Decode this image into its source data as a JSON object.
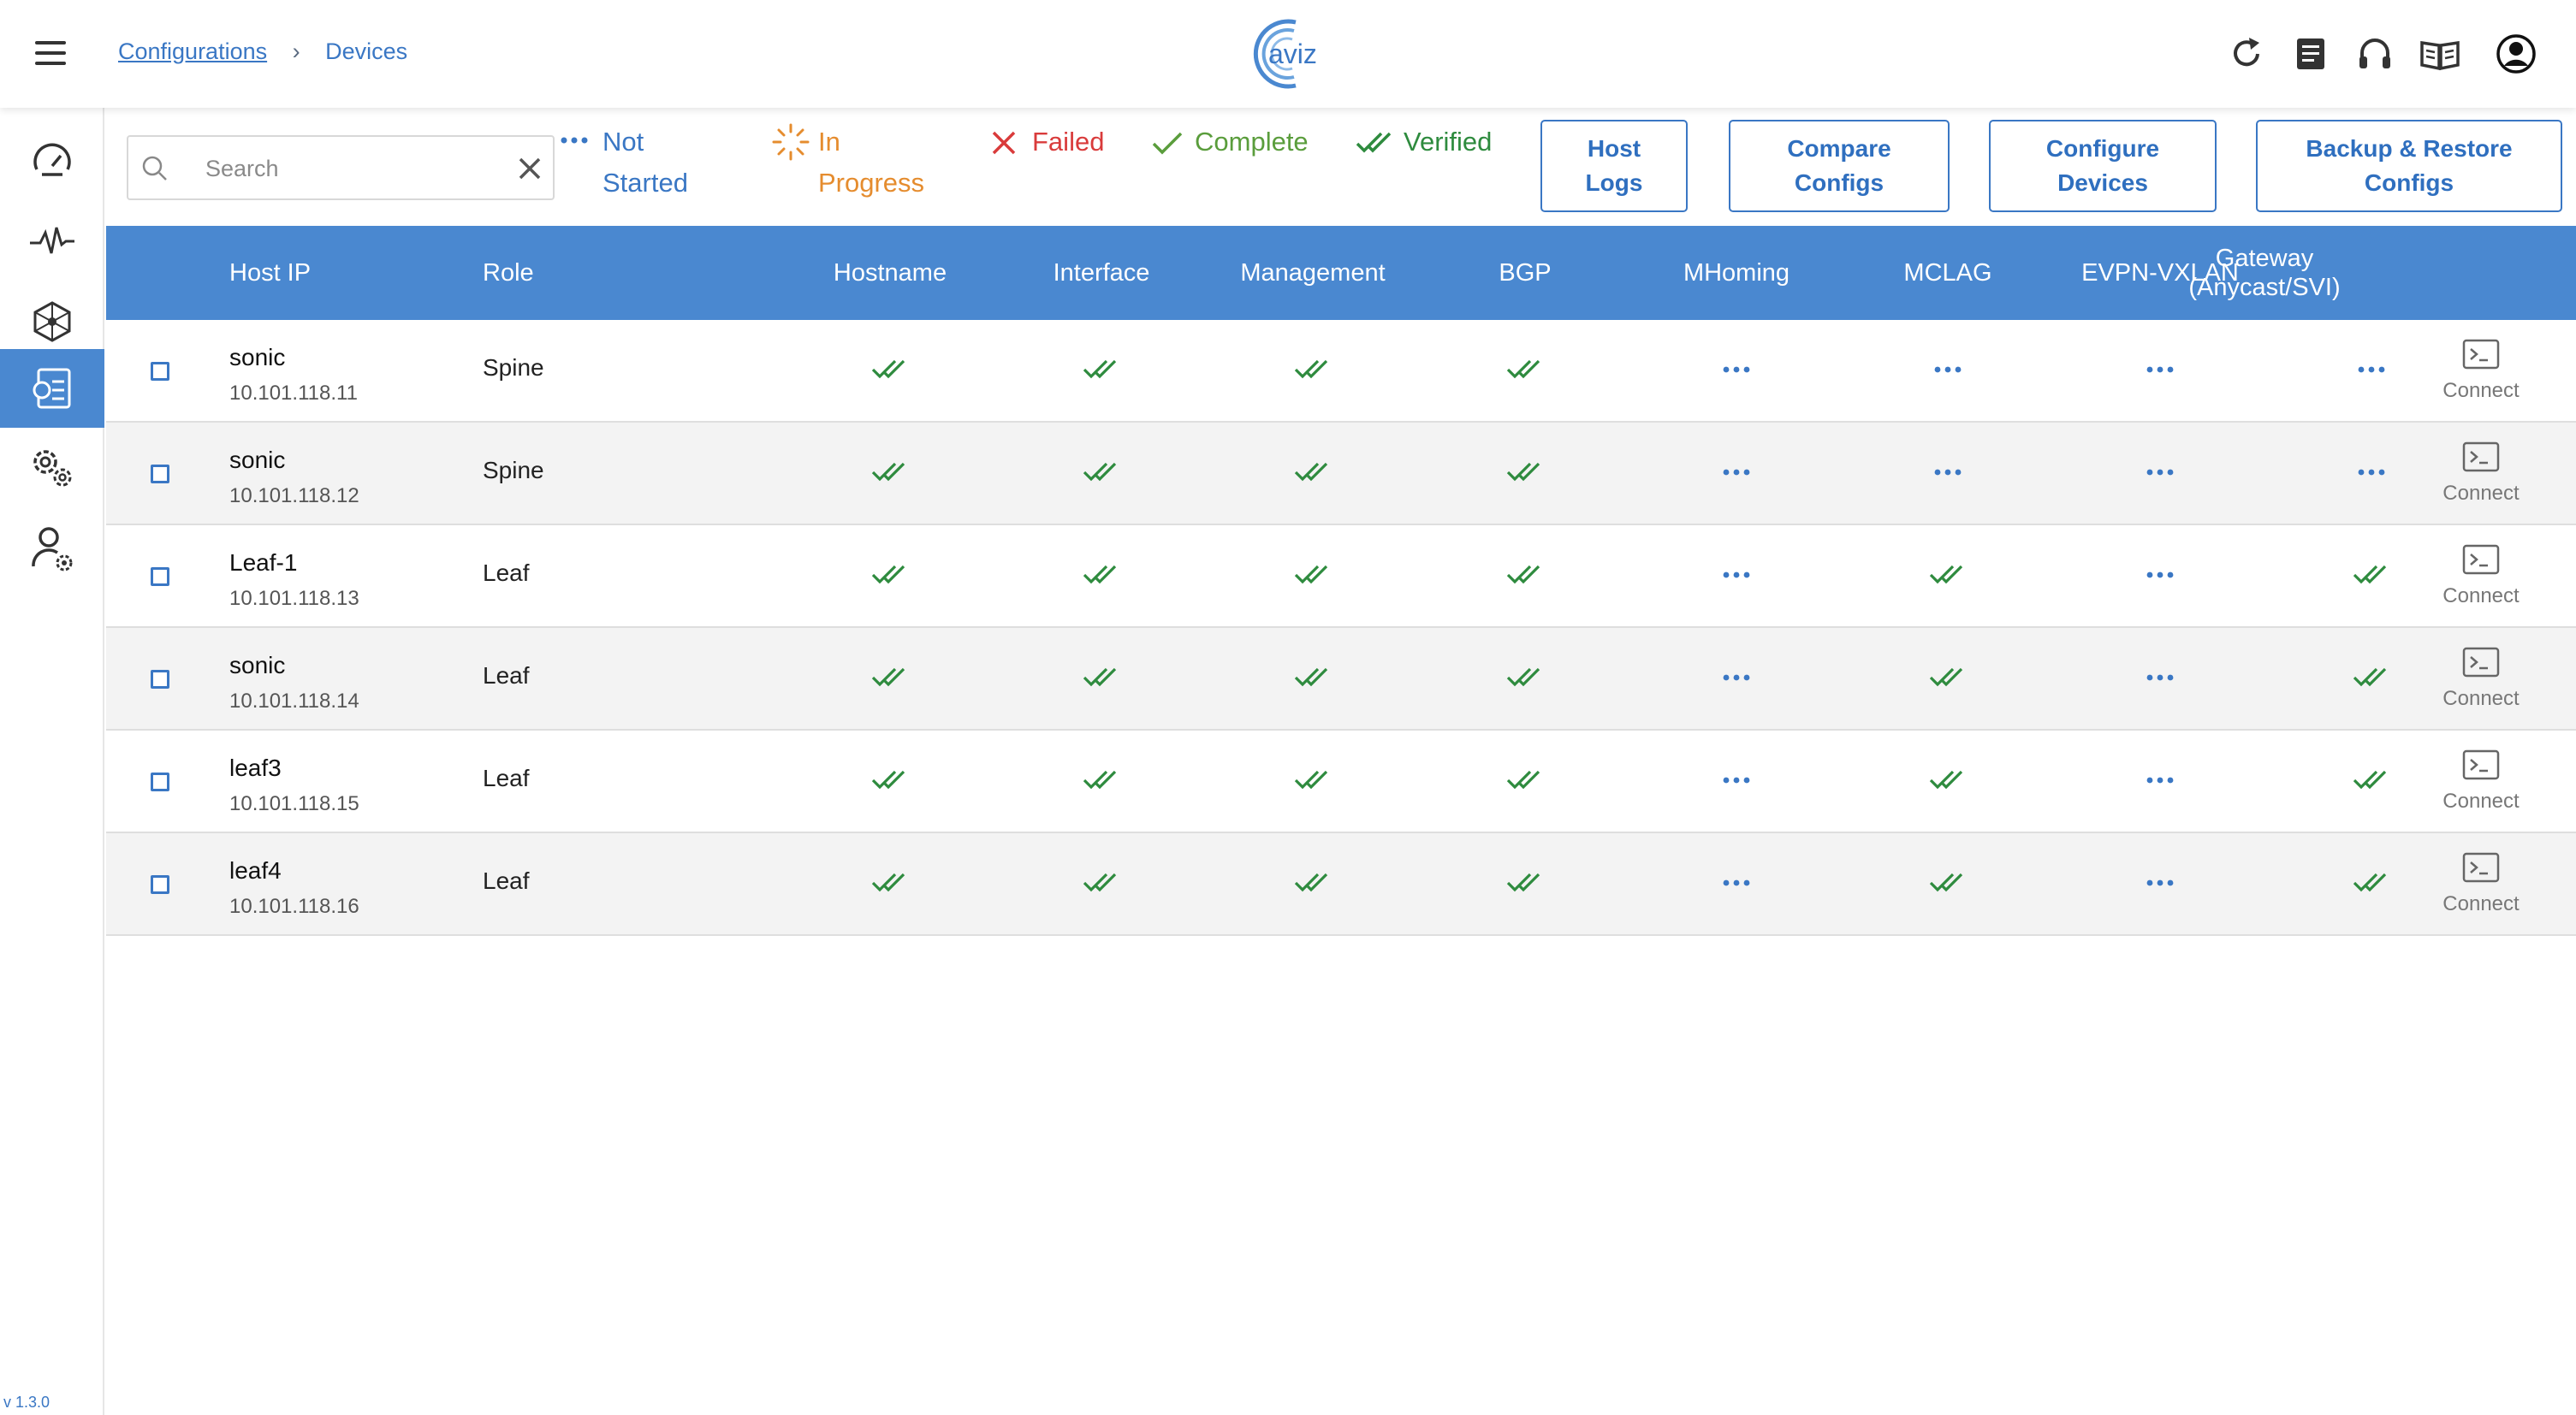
{
  "header": {
    "breadcrumb_root": "Configurations",
    "breadcrumb_sep": "›",
    "breadcrumb_current": "Devices",
    "logo_text": "aviz"
  },
  "sidebar": {
    "items": [
      "dashboard-icon",
      "monitoring-icon",
      "topology-icon",
      "configurations-icon",
      "settings-icon",
      "user-settings-icon"
    ],
    "active_index": 3,
    "version": "v 1.3.0"
  },
  "toolbar": {
    "search_placeholder": "Search",
    "legend": {
      "not_started": "Not Started",
      "in_progress": "In Progress",
      "failed": "Failed",
      "complete": "Complete",
      "verified": "Verified"
    },
    "buttons": {
      "host_logs": "Host Logs",
      "compare_configs": "Compare Configs",
      "configure_devices": "Configure Devices",
      "backup_restore": "Backup & Restore Configs"
    }
  },
  "colors": {
    "accent": "#4a88d0",
    "link": "#3a77c4",
    "verified": "#2e8b3e",
    "complete": "#5a9d3c",
    "failed": "#d93b3b",
    "in_progress": "#e58c2e",
    "not_started": "#3a77c4"
  },
  "table": {
    "columns": {
      "host_ip": "Host IP",
      "role": "Role",
      "hostname": "Hostname",
      "interface": "Interface",
      "management": "Management",
      "bgp": "BGP",
      "mhoming": "MHoming",
      "mclag": "MCLAG",
      "evpn_vxlan": "EVPN-VXLAN",
      "gateway": "Gateway (Anycast/SVI)"
    },
    "connect_label": "Connect",
    "rows": [
      {
        "host": "sonic",
        "ip": "10.101.118.11",
        "role": "Spine",
        "hostname": "verified",
        "interface": "verified",
        "management": "verified",
        "bgp": "verified",
        "mhoming": "not_started",
        "mclag": "not_started",
        "evpn_vxlan": "not_started",
        "gateway": "not_started"
      },
      {
        "host": "sonic",
        "ip": "10.101.118.12",
        "role": "Spine",
        "hostname": "verified",
        "interface": "verified",
        "management": "verified",
        "bgp": "verified",
        "mhoming": "not_started",
        "mclag": "not_started",
        "evpn_vxlan": "not_started",
        "gateway": "not_started"
      },
      {
        "host": "Leaf-1",
        "ip": "10.101.118.13",
        "role": "Leaf",
        "hostname": "verified",
        "interface": "verified",
        "management": "verified",
        "bgp": "verified",
        "mhoming": "not_started",
        "mclag": "verified",
        "evpn_vxlan": "not_started",
        "gateway": "verified"
      },
      {
        "host": "sonic",
        "ip": "10.101.118.14",
        "role": "Leaf",
        "hostname": "verified",
        "interface": "verified",
        "management": "verified",
        "bgp": "verified",
        "mhoming": "not_started",
        "mclag": "verified",
        "evpn_vxlan": "not_started",
        "gateway": "verified"
      },
      {
        "host": "leaf3",
        "ip": "10.101.118.15",
        "role": "Leaf",
        "hostname": "verified",
        "interface": "verified",
        "management": "verified",
        "bgp": "verified",
        "mhoming": "not_started",
        "mclag": "verified",
        "evpn_vxlan": "not_started",
        "gateway": "verified"
      },
      {
        "host": "leaf4",
        "ip": "10.101.118.16",
        "role": "Leaf",
        "hostname": "verified",
        "interface": "verified",
        "management": "verified",
        "bgp": "verified",
        "mhoming": "not_started",
        "mclag": "verified",
        "evpn_vxlan": "not_started",
        "gateway": "verified"
      }
    ]
  }
}
